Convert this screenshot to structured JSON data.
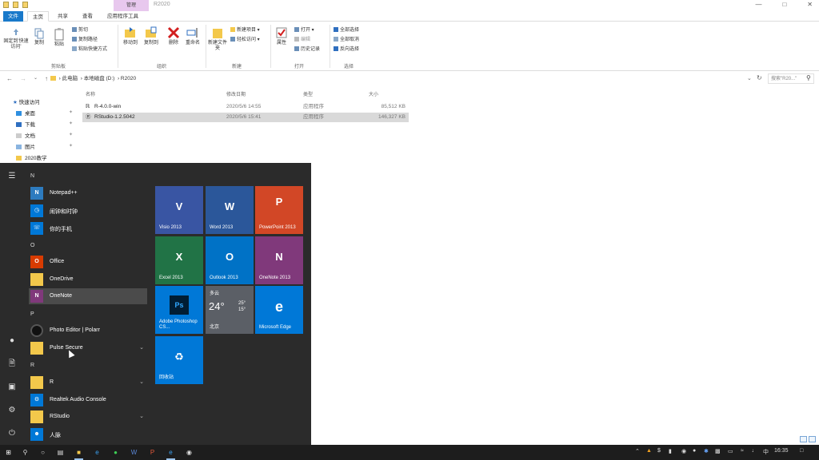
{
  "titlebar": {
    "context_tab": "管理",
    "window_title": "R2020",
    "minimize_icon": "minimize-icon",
    "maximize_icon": "maximize-icon",
    "close_icon": "close-icon"
  },
  "tabs": [
    "文件",
    "主页",
    "共享",
    "查看",
    "应用程序工具"
  ],
  "ribbon": {
    "clipboard": {
      "pin_label": "固定到'快速访问'",
      "copy_label": "复制",
      "paste_label": "粘贴",
      "cut_label": "剪切",
      "copy_path_label": "复制路径",
      "paste_shortcut_label": "粘贴快捷方式",
      "group_label": "剪贴板"
    },
    "organize": {
      "move_to_label": "移动到",
      "copy_to_label": "复制到",
      "delete_label": "删除",
      "rename_label": "重命名",
      "group_label": "组织"
    },
    "new": {
      "new_folder_label": "新建文件夹",
      "new_item_label": "新建项目",
      "easy_access_label": "轻松访问",
      "group_label": "新建"
    },
    "open": {
      "properties_label": "属性",
      "open_label": "打开",
      "edit_label": "编辑",
      "history_label": "历史记录",
      "group_label": "打开"
    },
    "select": {
      "select_all_label": "全部选择",
      "select_none_label": "全部取消",
      "invert_label": "反向选择",
      "group_label": "选择"
    }
  },
  "address": {
    "path": [
      "此电脑",
      "本地磁盘 (D:)",
      "R2020"
    ],
    "search_placeholder": "搜索\"R20...\""
  },
  "navpane": {
    "quick_access": "快速访问",
    "items": [
      "桌面",
      "下载",
      "文档",
      "图片",
      "2020教学"
    ]
  },
  "filelist": {
    "columns": [
      "名称",
      "修改日期",
      "类型",
      "大小"
    ],
    "rows": [
      {
        "name": "R-4.0.0-win",
        "date": "2020/5/6 14:55",
        "type": "应用程序",
        "size": "85,512 KB",
        "selected": false
      },
      {
        "name": "RStudio-1.2.5042",
        "date": "2020/5/6 15:41",
        "type": "应用程序",
        "size": "146,327 KB",
        "selected": true
      }
    ]
  },
  "startmenu": {
    "letters": {
      "n": "N",
      "o": "O",
      "p": "P",
      "r": "R"
    },
    "apps": {
      "notepadpp": "Notepad++",
      "alarm": "闹钟和时钟",
      "phone": "你的手机",
      "office": "Office",
      "onedrive": "OneDrive",
      "onenote": "OneNote",
      "photo_editor": "Photo Editor | Polarr",
      "pulse": "Pulse Secure",
      "r": "R",
      "realtek": "Realtek Audio Console",
      "rstudio": "RStudio",
      "people": "人脉"
    },
    "tiles": {
      "visio": "Visio 2013",
      "word": "Word 2013",
      "powerpoint": "PowerPoint 2013",
      "excel": "Excel 2013",
      "outlook": "Outlook 2013",
      "onenote": "OneNote 2013",
      "photoshop": "Adobe Photoshop CS...",
      "weather_cond": "多云",
      "weather_temp": "24°",
      "weather_hi": "25°",
      "weather_lo": "15°",
      "weather_city": "北京",
      "edge": "Microsoft Edge",
      "recycle": "回收站"
    },
    "colors": {
      "visio": "#3955a3",
      "word": "#2b579a",
      "powerpoint": "#d24726",
      "excel": "#217346",
      "outlook": "#0072c6",
      "onenote": "#80397b",
      "photoshop": "#0078d7",
      "weather": "#5b5f66",
      "edge": "#0078d7",
      "recycle": "#0078d7"
    }
  },
  "taskbar": {
    "clock": "16:35",
    "ime": "中"
  }
}
